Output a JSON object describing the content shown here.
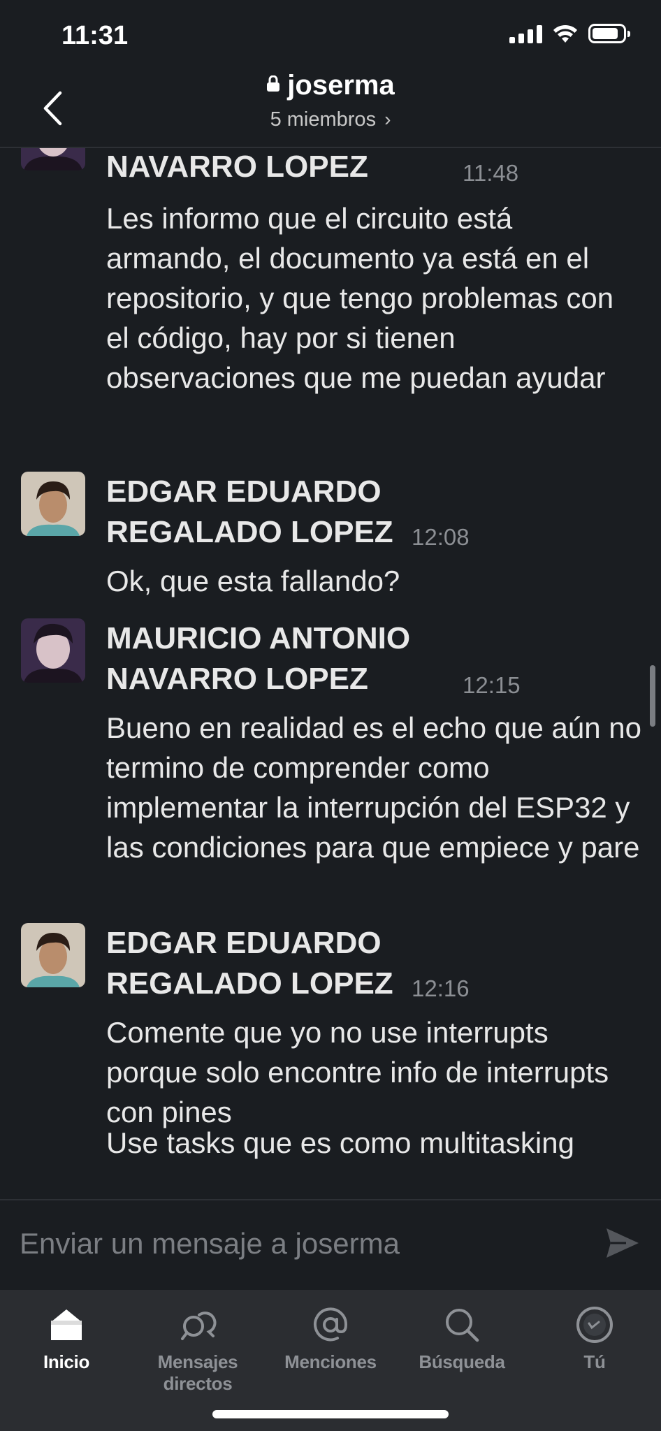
{
  "status_bar": {
    "time": "11:31"
  },
  "header": {
    "channel_name": "joserma",
    "members": "5 miembros"
  },
  "messages": [
    {
      "author": "MAURICIO ANTONIO NAVARRO LOPEZ",
      "time": "11:48",
      "avatar": "avatar-mauricio",
      "text": "Les informo que el circuito está armando, el documento ya está en el repositorio, y que tengo problemas con el código, hay por si tienen observaciones que me puedan ayudar"
    },
    {
      "author": "EDGAR EDUARDO REGALADO LOPEZ",
      "time": "12:08",
      "avatar": "avatar-edgar",
      "text": "Ok, que esta fallando?"
    },
    {
      "author": "MAURICIO ANTONIO NAVARRO LOPEZ",
      "time": "12:15",
      "avatar": "avatar-mauricio",
      "text": "Bueno en realidad es el echo que aún no termino de comprender como implementar la interrupción del ESP32 y las condiciones para que empiece y pare"
    },
    {
      "author": "EDGAR EDUARDO REGALADO LOPEZ",
      "time": "12:16",
      "avatar": "avatar-edgar",
      "text": "Comente que yo no use interrupts porque solo encontre info de interrupts con pines",
      "continuation": "Use tasks que es como multitasking"
    }
  ],
  "composer": {
    "placeholder": "Enviar un mensaje a joserma"
  },
  "tabs": [
    {
      "label": "Inicio",
      "icon": "home-icon",
      "active": true
    },
    {
      "label": "Mensajes directos",
      "icon": "direct-messages-icon",
      "active": false
    },
    {
      "label": "Menciones",
      "icon": "at-mention-icon",
      "active": false
    },
    {
      "label": "Búsqueda",
      "icon": "search-icon",
      "active": false
    },
    {
      "label": "Tú",
      "icon": "profile-icon",
      "active": false
    }
  ],
  "colors": {
    "background": "#1a1d21",
    "tabbar": "#2b2d31",
    "text": "#e8e8e8",
    "muted": "#8c8f94"
  }
}
